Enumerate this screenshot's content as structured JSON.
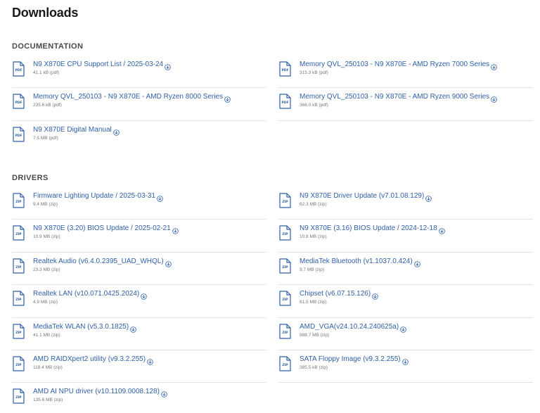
{
  "page": {
    "title": "Downloads"
  },
  "colors": {
    "link": "#2f5fa8",
    "meta": "#777777",
    "divider": "#e2e2e2"
  },
  "icons": {
    "file": "document-icon",
    "download": "download-circle-icon"
  },
  "sections": [
    {
      "title": "DOCUMENTATION",
      "ext": "PDF",
      "items": [
        {
          "name": "N9 X870E CPU Support List / 2025-03-24",
          "meta": "41.1 kB (pdf)"
        },
        {
          "name": "Memory QVL_250103 - N9 X870E - AMD Ryzen 7000 Series",
          "meta": "315.3 kB (pdf)"
        },
        {
          "name": "Memory QVL_250103 - N9 X870E - AMD Ryzen 8000 Series",
          "meta": "235.6 kB (pdf)"
        },
        {
          "name": "Memory QVL_250103 - N9 X870E - AMD Ryzen 9000 Series",
          "meta": "366.0 kB (pdf)"
        },
        {
          "name": "N9 X870E Digital Manual",
          "meta": "7.5 MB (pdf)"
        }
      ]
    },
    {
      "title": "DRIVERS",
      "ext": "ZIP",
      "items": [
        {
          "name": "Firmware Lighting Update / 2025-03-31",
          "meta": "9.4 MB (zip)"
        },
        {
          "name": "N9 X870E Driver Update (v7.01.08.129)",
          "meta": "62.3 MB (zip)"
        },
        {
          "name": "N9 X870E (3.20) BIOS Update / 2025-02-21",
          "meta": "10.9 MB (zip)"
        },
        {
          "name": "N9 X870E (3.16) BIOS Update / 2024-12-18",
          "meta": "10.8 MB (zip)"
        },
        {
          "name": "Realtek Audio (v6.4.0.2395_UAD_WHQL)",
          "meta": "23.3 MB (zip)"
        },
        {
          "name": "MediaTek Bluetooth (v1.1037.0.424)",
          "meta": "9.7 MB (zip)"
        },
        {
          "name": "Realtek LAN (v10.071.0425.2024)",
          "meta": "4.9 MB (zip)"
        },
        {
          "name": "Chipset (v6.07.15.126)",
          "meta": "61.5 MB (zip)"
        },
        {
          "name": "MediaTek WLAN (v5.3.0.1825)",
          "meta": "41.1 MB (zip)"
        },
        {
          "name": "AMD_VGA(v24.10.24.240625a)",
          "meta": "988.7 MB (zip)"
        },
        {
          "name": "AMD RAIDXpert2 utility (v9.3.2.255)",
          "meta": "118.4 MB (zip)"
        },
        {
          "name": "SATA Floppy Image (v9.3.2.255)",
          "meta": "385.5 kB (zip)"
        },
        {
          "name": "AMD AI NPU driver (v10.1109.0008.128)",
          "meta": "135.6 MB (zip)"
        }
      ]
    }
  ]
}
